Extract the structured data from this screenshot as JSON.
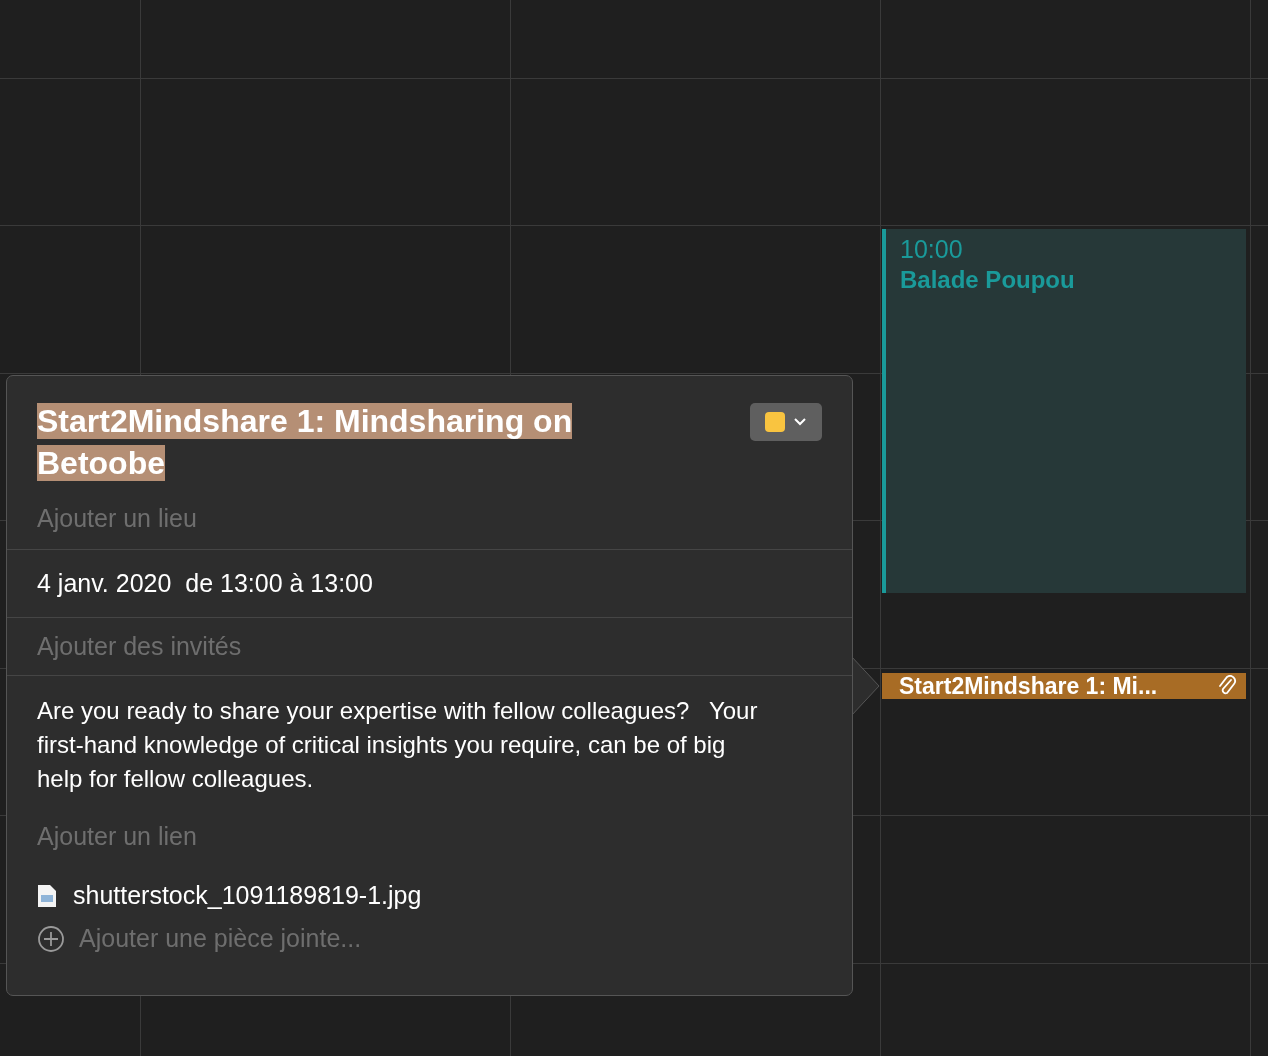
{
  "events": [
    {
      "time": "10:00",
      "title": "Balade Poupou",
      "color": "#1a9a9a",
      "has_attachment": false
    },
    {
      "title": "Start2Mindshare 1: Mi...",
      "color": "#a86c25",
      "has_attachment": true
    }
  ],
  "popover": {
    "title": {
      "text": "Start2Mindshare 1: Mindsharing on Betoobe",
      "selected": true
    },
    "location": {
      "placeholder": "Ajouter un lieu"
    },
    "date": "4 janv. 2020  de 13:00 à 13:00",
    "invitees": {
      "placeholder": "Ajouter des invités"
    },
    "notes": "Are you ready to share your expertise with fellow colleagues?   Your first-hand knowledge of critical insights you require, can be of big help for fellow colleagues.",
    "url": {
      "placeholder": "Ajouter un lien"
    },
    "attachments": [
      "shutterstock_1091189819-1.jpg"
    ],
    "add_attachment": "Ajouter une pièce jointe..."
  }
}
